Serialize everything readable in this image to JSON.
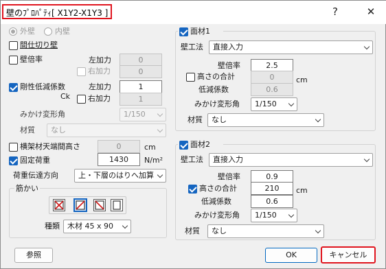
{
  "window": {
    "title": "壁のﾌﾟﾛﾊﾟﾃｨ[ X1Y2-X1Y3 ]",
    "help_label": "?",
    "close_label": "✕"
  },
  "left": {
    "wall_side": {
      "outer": "外壁",
      "inner": "内壁",
      "selected": "outer"
    },
    "partition_wall": {
      "label": "間仕切り壁",
      "checked": false
    },
    "wall_ratio": {
      "label": "壁倍率",
      "checked": false,
      "left_label": "左加力",
      "left_value": "0",
      "right_label": "右加力",
      "right_value": "0",
      "right_checked": false
    },
    "rigidity": {
      "label": "剛性低減係数",
      "sub_label": "Ck",
      "checked": true,
      "left_label": "左加力",
      "left_value": "1",
      "right_label": "右加力",
      "right_value": "1",
      "right_checked": false
    },
    "apparent_angle": {
      "label": "みかけ変形角",
      "value": "1/150"
    },
    "material": {
      "label": "材質",
      "value": "なし"
    },
    "frame_height": {
      "label": "横架材天端間高さ",
      "checked": false,
      "value": "0",
      "unit": "cm"
    },
    "fixed_load": {
      "label": "固定荷重",
      "checked": true,
      "value": "1430",
      "unit": "N/m²"
    },
    "load_transfer": {
      "label": "荷重伝達方向",
      "value": "上・下層のはりへ加算"
    },
    "brace": {
      "group_label": "筋かい",
      "icons": [
        "brace-cross-icon",
        "brace-slash-icon",
        "brace-backslash-icon",
        "brace-none-icon"
      ],
      "selected_index": 1,
      "type_label": "種類",
      "type_value": "木材 45 x 90"
    }
  },
  "facing1": {
    "label": "面材1",
    "checked": true,
    "method_label": "壁工法",
    "method_value": "直接入力",
    "ratio_label": "壁倍率",
    "ratio_value": "2.5",
    "height_label": "高さの合計",
    "height_checked": false,
    "height_value": "0",
    "height_unit": "cm",
    "reduction_label": "低減係数",
    "reduction_value": "0.6",
    "angle_label": "みかけ変形角",
    "angle_value": "1/150",
    "material_label": "材質",
    "material_value": "なし"
  },
  "facing2": {
    "label": "面材2",
    "checked": true,
    "method_label": "壁工法",
    "method_value": "直接入力",
    "ratio_label": "壁倍率",
    "ratio_value": "0.9",
    "height_label": "高さの合計",
    "height_checked": true,
    "height_value": "210",
    "height_unit": "cm",
    "reduction_label": "低減係数",
    "reduction_value": "0.6",
    "angle_label": "みかけ変形角",
    "angle_value": "1/150",
    "material_label": "材質",
    "material_value": "なし"
  },
  "footer": {
    "reference_label": "参照",
    "ok_label": "OK",
    "cancel_label": "キャンセル"
  },
  "colors": {
    "accent": "#1565c0",
    "highlight": "#e0141e"
  }
}
